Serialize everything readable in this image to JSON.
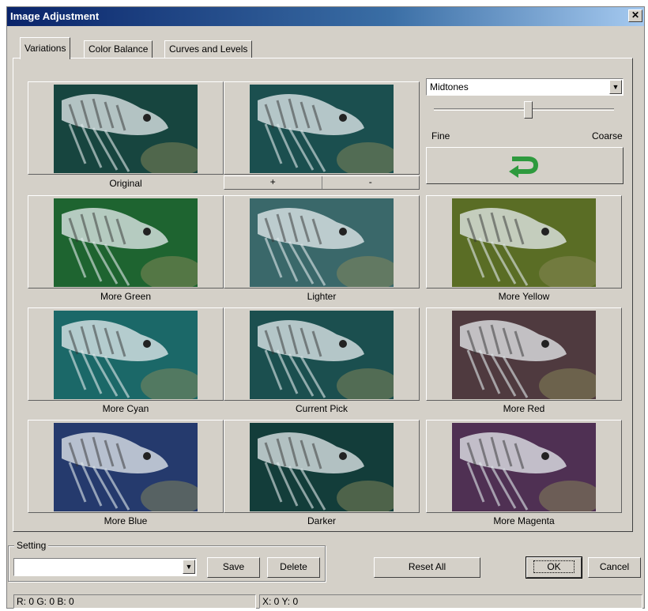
{
  "window": {
    "title": "Image Adjustment",
    "close_glyph": "✕"
  },
  "tabs": [
    {
      "label": "Variations",
      "active": true
    },
    {
      "label": "Color Balance",
      "active": false
    },
    {
      "label": "Curves and Levels",
      "active": false
    }
  ],
  "variations": {
    "original_label": "Original",
    "plus_label": "+",
    "minus_label": "-",
    "tiles": [
      {
        "label": "More Green",
        "tint": "#2f9a4a"
      },
      {
        "label": "Lighter",
        "tint": "#5aa0a4"
      },
      {
        "label": "More Yellow",
        "tint": "#8aa83a"
      },
      {
        "label": "More Cyan",
        "tint": "#2aa0a0"
      },
      {
        "label": "Current Pick",
        "tint": "#2a7a7a"
      },
      {
        "label": "More Red",
        "tint": "#7a5a62"
      },
      {
        "label": "More Blue",
        "tint": "#3a5aa8"
      },
      {
        "label": "Darker",
        "tint": "#1e5e5a"
      },
      {
        "label": "More Magenta",
        "tint": "#7a4a80"
      }
    ]
  },
  "tone": {
    "selected": "Midtones"
  },
  "slider": {
    "fine_label": "Fine",
    "coarse_label": "Coarse",
    "value_fraction": 0.52
  },
  "undo_icon": "undo-arrow-icon",
  "undo_color": "#2e9a3e",
  "setting": {
    "group_label": "Setting",
    "value": "",
    "save_label": "Save",
    "delete_label": "Delete"
  },
  "buttons": {
    "reset_all": "Reset All",
    "ok": "OK",
    "cancel": "Cancel"
  },
  "status": {
    "rgb": "R: 0 G: 0 B: 0",
    "xy": "X: 0 Y: 0"
  }
}
